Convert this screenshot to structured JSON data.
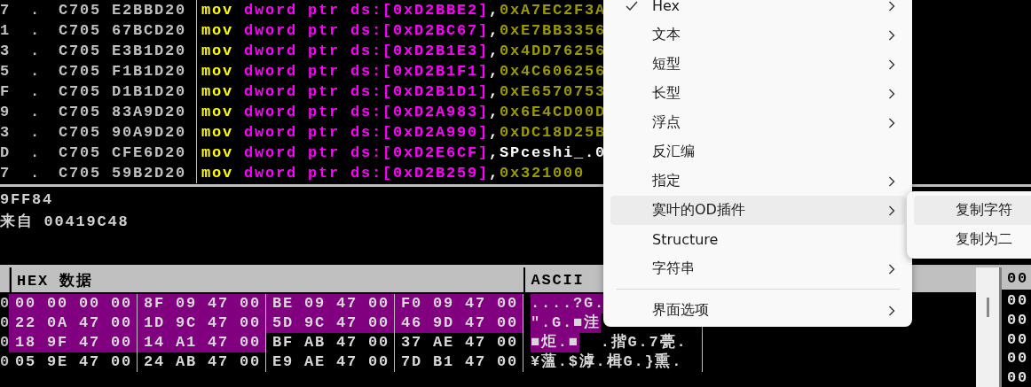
{
  "disassembly": {
    "rows": [
      {
        "address": "7",
        "marker": ".",
        "bytes": "C705 E2BBD20",
        "mnemonic": "mov",
        "operand": "dword ptr ds:[0xD2BBE2]",
        "separator": ",",
        "value": "0xA7EC2F3A",
        "is_symbol": false
      },
      {
        "address": "1",
        "marker": ".",
        "bytes": "C705 67BCD20",
        "mnemonic": "mov",
        "operand": "dword ptr ds:[0xD2BC67]",
        "separator": ",",
        "value": "0xE7BB3356",
        "is_symbol": false
      },
      {
        "address": "3",
        "marker": ".",
        "bytes": "C705 E3B1D20",
        "mnemonic": "mov",
        "operand": "dword ptr ds:[0xD2B1E3]",
        "separator": ",",
        "value": "0x4DD76256",
        "is_symbol": false
      },
      {
        "address": "5",
        "marker": ".",
        "bytes": "C705 F1B1D20",
        "mnemonic": "mov",
        "operand": "dword ptr ds:[0xD2B1F1]",
        "separator": ",",
        "value": "0x4C606256",
        "is_symbol": false
      },
      {
        "address": "F",
        "marker": ".",
        "bytes": "C705 D1B1D20",
        "mnemonic": "mov",
        "operand": "dword ptr ds:[0xD2B1D1]",
        "separator": ",",
        "value": "0xE6570753",
        "is_symbol": false
      },
      {
        "address": "9",
        "marker": ".",
        "bytes": "C705 83A9D20",
        "mnemonic": "mov",
        "operand": "dword ptr ds:[0xD2A983]",
        "separator": ",",
        "value": "0x6E4CD00D",
        "is_symbol": false
      },
      {
        "address": "3",
        "marker": ".",
        "bytes": "C705 90A9D20",
        "mnemonic": "mov",
        "operand": "dword ptr ds:[0xD2A990]",
        "separator": ",",
        "value": "0xDC18D25B",
        "is_symbol": false
      },
      {
        "address": "D",
        "marker": ".",
        "bytes": "C705 CFE6D20",
        "mnemonic": "mov",
        "operand": "dword ptr ds:[0xD2E6CF]",
        "separator": ",",
        "value": "SPceshi_.0",
        "is_symbol": true
      },
      {
        "address": "7",
        "marker": ".",
        "bytes": "C705 59B2D20",
        "mnemonic": "mov",
        "operand": "dword ptr ds:[0xD2B259]",
        "separator": ",",
        "value": "0x321000",
        "is_symbol": false
      }
    ]
  },
  "info": {
    "lines": [
      "9FF84",
      "来自 00419C48"
    ]
  },
  "dump": {
    "columns": [
      "HEX 数据",
      "ASCII"
    ],
    "rows": [
      {
        "address": "0",
        "groups": [
          {
            "bytes": "00 00 00 00",
            "selected": true
          },
          {
            "bytes": "8F 09 47 00",
            "selected": true
          },
          {
            "bytes": "BE 09 47 00",
            "selected": true
          },
          {
            "bytes": "F0 09 47 00",
            "selected": true
          }
        ],
        "ascii": [
          {
            "text": "....?G.",
            "selected": true
          }
        ]
      },
      {
        "address": "0",
        "groups": [
          {
            "bytes": "22 0A 47 00",
            "selected": true
          },
          {
            "bytes": "1D 9C 47 00",
            "selected": true
          },
          {
            "bytes": "5D 9C 47 00",
            "selected": true
          },
          {
            "bytes": "46 9D 47 00",
            "selected": true
          }
        ],
        "ascii": [
          {
            "text": "\".G.■洼",
            "selected": true
          }
        ]
      },
      {
        "address": "0",
        "groups": [
          {
            "bytes": "18 9F 47 00",
            "selected": true
          },
          {
            "bytes": "14 A1 47 00",
            "selected": true
          },
          {
            "bytes": "BF AB 47 00",
            "selected": false
          },
          {
            "bytes": "37 AE 47 00",
            "selected": false
          }
        ],
        "ascii": [
          {
            "text": "■炬.■",
            "selected": true
          },
          {
            "text": "  .揩G.7甍.",
            "selected": false
          }
        ]
      },
      {
        "address": "0",
        "groups": [
          {
            "bytes": "05 9E 47 00",
            "selected": false
          },
          {
            "bytes": "24 AB 47 00",
            "selected": false
          },
          {
            "bytes": "E9 AE 47 00",
            "selected": false
          },
          {
            "bytes": "7D B1 47 00",
            "selected": false
          }
        ],
        "ascii": [
          {
            "text": "¥薀.$滹.楫G.}熏.",
            "selected": false
          }
        ]
      }
    ]
  },
  "stack": {
    "header": "00",
    "rows": [
      "00",
      "00",
      "00",
      "00",
      "00"
    ]
  },
  "menu": {
    "items": [
      {
        "kind": "item",
        "label": "Hex",
        "checked": true,
        "submenu": true,
        "selected": false
      },
      {
        "kind": "item",
        "label": "文本",
        "checked": false,
        "submenu": true,
        "selected": false
      },
      {
        "kind": "item",
        "label": "短型",
        "checked": false,
        "submenu": true,
        "selected": false
      },
      {
        "kind": "item",
        "label": "长型",
        "checked": false,
        "submenu": true,
        "selected": false
      },
      {
        "kind": "item",
        "label": "浮点",
        "checked": false,
        "submenu": true,
        "selected": false
      },
      {
        "kind": "item",
        "label": "反汇编",
        "checked": false,
        "submenu": false,
        "selected": false
      },
      {
        "kind": "item",
        "label": "指定",
        "checked": false,
        "submenu": true,
        "selected": false
      },
      {
        "kind": "item",
        "label": "寞叶的OD插件",
        "checked": false,
        "submenu": true,
        "selected": true
      },
      {
        "kind": "item",
        "label": "Structure",
        "checked": false,
        "submenu": false,
        "selected": false
      },
      {
        "kind": "item",
        "label": "字符串",
        "checked": false,
        "submenu": true,
        "selected": false
      },
      {
        "kind": "separator"
      },
      {
        "kind": "item",
        "label": "界面选项",
        "checked": false,
        "submenu": true,
        "selected": false
      }
    ]
  },
  "submenu": {
    "items": [
      {
        "label": "复制字符",
        "selected": true
      },
      {
        "label": "复制为二",
        "selected": false
      }
    ]
  }
}
